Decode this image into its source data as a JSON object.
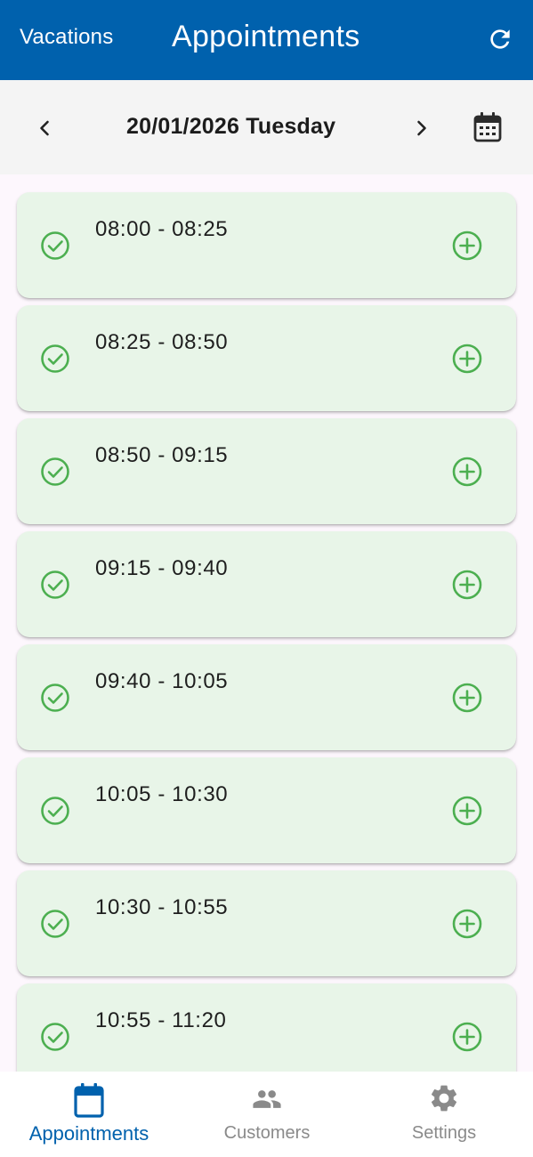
{
  "appbar": {
    "vacations_label": "Vacations",
    "title": "Appointments",
    "refresh_icon": "refresh-icon"
  },
  "datebar": {
    "date": "20/01/2026 Tuesday",
    "prev_icon": "chevron-left-icon",
    "next_icon": "chevron-right-icon",
    "calendar_icon": "calendar-icon"
  },
  "slots": [
    {
      "time": "08:00 - 08:25"
    },
    {
      "time": "08:25 - 08:50"
    },
    {
      "time": "08:50 - 09:15"
    },
    {
      "time": "09:15 - 09:40"
    },
    {
      "time": "09:40 - 10:05"
    },
    {
      "time": "10:05 - 10:30"
    },
    {
      "time": "10:30 - 10:55"
    },
    {
      "time": "10:55 - 11:20"
    }
  ],
  "bottomnav": {
    "items": [
      {
        "label": "Appointments",
        "icon": "calendar-icon",
        "active": true
      },
      {
        "label": "Customers",
        "icon": "people-icon",
        "active": false
      },
      {
        "label": "Settings",
        "icon": "gear-icon",
        "active": false
      }
    ]
  },
  "colors": {
    "primary": "#0061ad",
    "slot_bg": "#e8f5e8",
    "slot_icon": "#4caf50",
    "inactive_nav": "#8a8a8a"
  }
}
